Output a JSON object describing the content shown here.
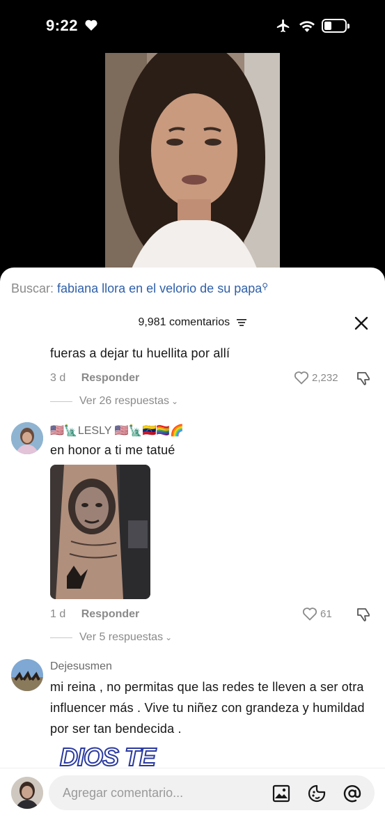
{
  "status": {
    "time": "9:22"
  },
  "search": {
    "label": "Buscar:",
    "query": "fabiana llora en el velorio de su papa"
  },
  "comments_header": {
    "count_text": "9,981 comentarios"
  },
  "comments": [
    {
      "partial_text": "fueras a dejar tu huellita por allí",
      "age": "3 d",
      "reply_label": "Responder",
      "likes": "2,232",
      "view_replies": "Ver 26 respuestas"
    },
    {
      "username": "🇺🇸🗽LESLY 🇺🇸🗽🇻🇪🏳️‍🌈🌈",
      "text": "en honor a ti me tatué",
      "age": "1 d",
      "reply_label": "Responder",
      "likes": "61",
      "view_replies": "Ver 5 respuestas"
    },
    {
      "username": "Dejesusmen",
      "text": "mi reina , no permitas que las redes te lleven a ser otra influencer más . Vive tu niñez con grandeza y humildad por ser tan bendecida .",
      "sticker_text": "DIOS TE"
    }
  ],
  "composer": {
    "placeholder": "Agregar comentario..."
  },
  "colors": {
    "link_blue": "#2e5fa8",
    "muted": "#8a8a8a",
    "text": "#161616"
  }
}
